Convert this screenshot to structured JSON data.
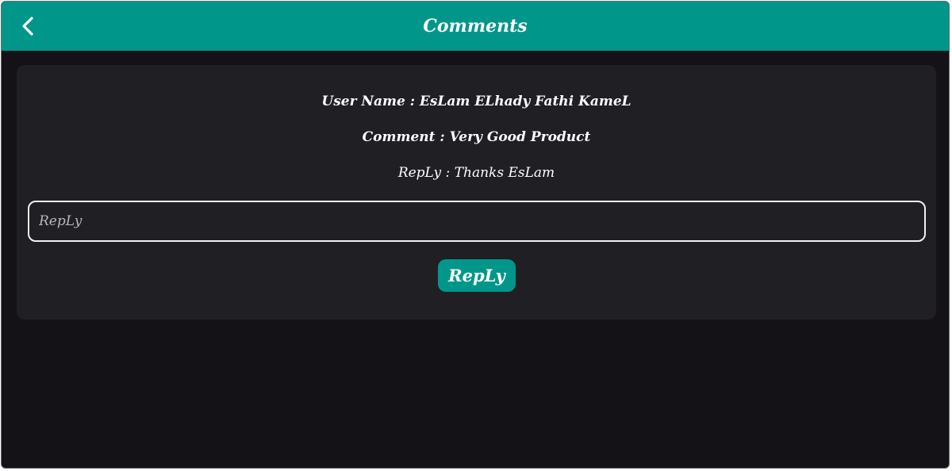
{
  "appbar": {
    "title": "Comments",
    "back_icon": "chevron-left-icon",
    "color": "#00978a"
  },
  "comment": {
    "user_name_line": "User Name : EsLam ELhady Fathi KameL",
    "comment_line": "Comment : Very Good Product",
    "reply_line": "RepLy : Thanks EsLam"
  },
  "reply_form": {
    "input_value": "",
    "input_placeholder": "RepLy",
    "submit_label": "RepLy"
  },
  "colors": {
    "background": "#141217",
    "card": "#201f23",
    "accent": "#00978a"
  }
}
